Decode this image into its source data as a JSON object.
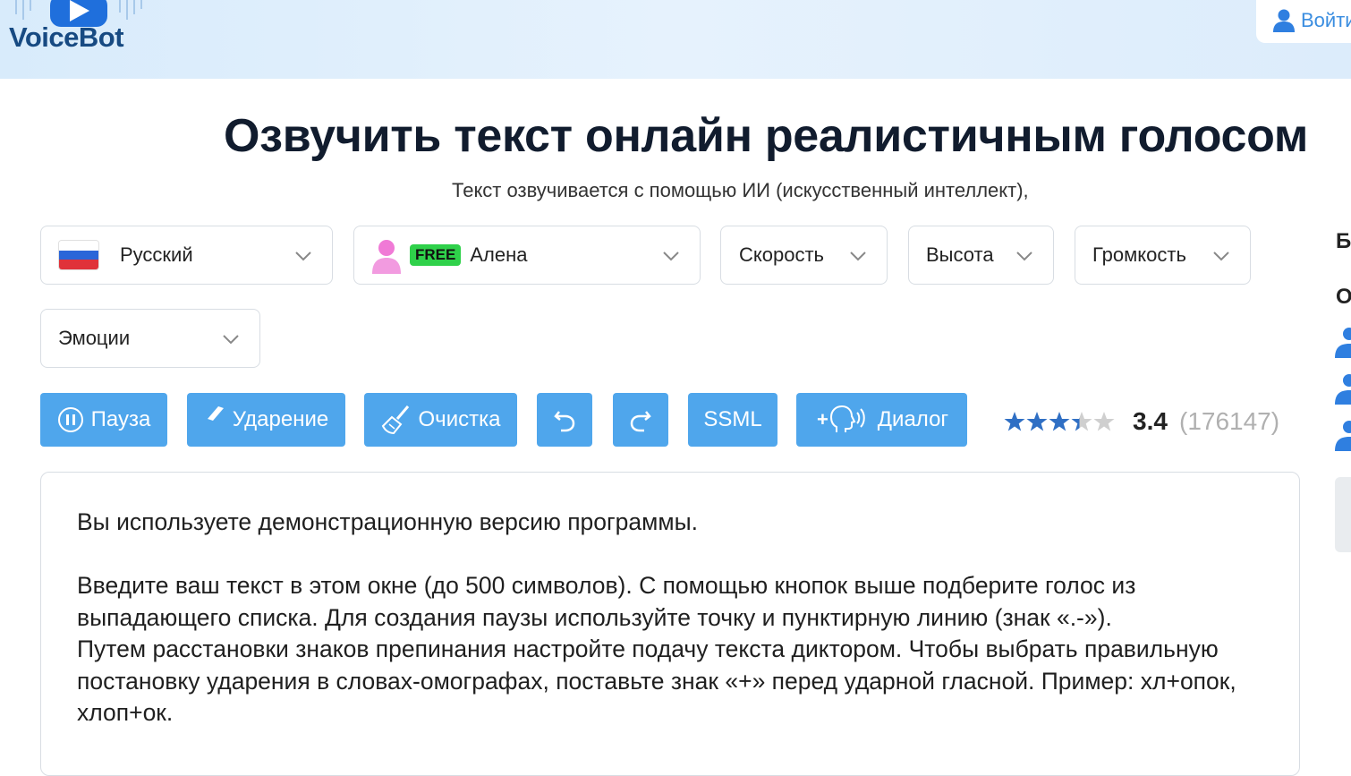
{
  "header": {
    "logo_text": "VoiceBot",
    "login_label": "Войти"
  },
  "page": {
    "title": "Озвучить текст онлайн реалистичным голосом",
    "subtitle": "Текст озвучивается с помощью ИИ (искусственный интеллект),"
  },
  "controls": {
    "language": "Русский",
    "voice_badge": "FREE",
    "voice": "Алена",
    "speed": "Скорость",
    "pitch": "Высота",
    "volume": "Громкость",
    "emotions": "Эмоции"
  },
  "toolbar": {
    "pause": "Пауза",
    "stress": "Ударение",
    "clear": "Очистка",
    "ssml": "SSML",
    "dialog": "Диалог"
  },
  "rating": {
    "value": "3.4",
    "count": "(176147)",
    "stars": 3.4
  },
  "editor": {
    "text": "Вы используете демонстрационную версию программы.\n\nВведите ваш текст в этом окне (до 500 символов). С помощью кнопок выше подберите голос из выпадающего списка. Для создания паузы используйте точку и пунктирную линию (знак «.-»).\nПутем расстановки знаков препинания настройте подачу текста диктором. Чтобы выбрать правильную постановку ударения в словах-омографах, поставьте знак «+» перед ударной гласной. Пример: хл+опок, хлоп+ок."
  },
  "sidebar": {
    "letter_b": "Б",
    "letter_o": "О"
  },
  "colors": {
    "accent": "#4fa6ec",
    "title": "#111c2e",
    "free": "#2fd14a",
    "star": "#2f6fc4"
  }
}
